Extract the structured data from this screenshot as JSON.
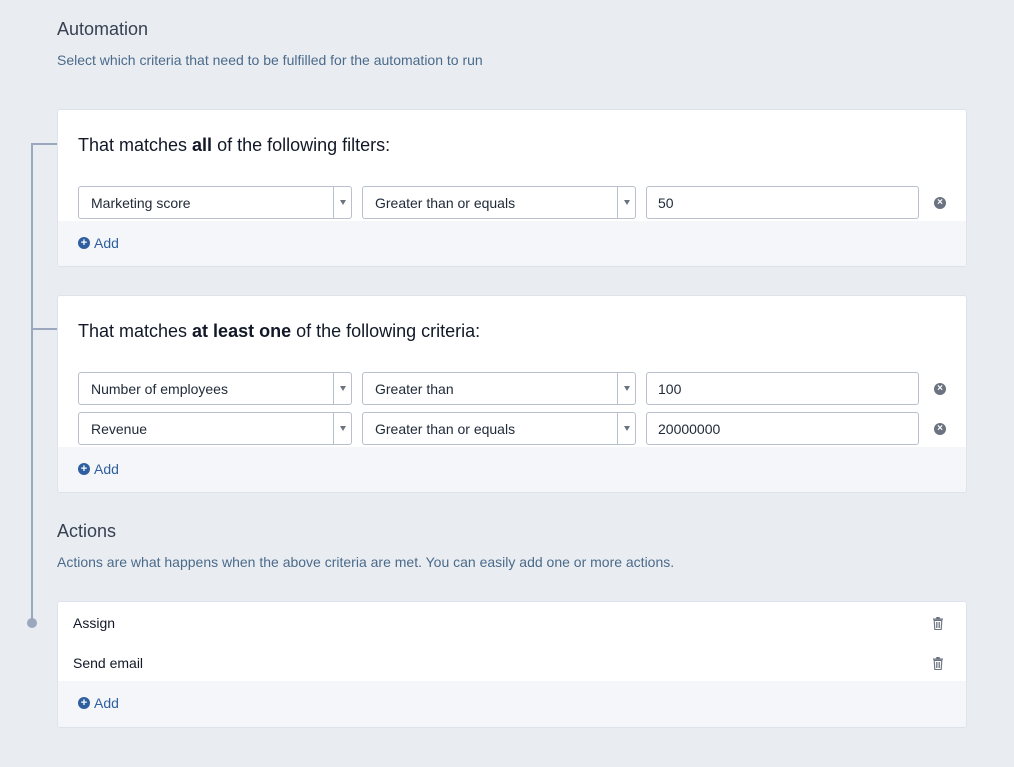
{
  "automation": {
    "title": "Automation",
    "description": "Select which criteria that need to be fulfilled for the automation to run"
  },
  "filters_all": {
    "heading_pre": "That matches ",
    "heading_bold": "all",
    "heading_post": " of the following filters:",
    "rows": [
      {
        "field": "Marketing score",
        "operator": "Greater than or equals",
        "value": "50"
      }
    ],
    "add_label": "Add"
  },
  "filters_any": {
    "heading_pre": "That matches ",
    "heading_bold": "at least one",
    "heading_post": " of the following criteria:",
    "rows": [
      {
        "field": "Number of employees",
        "operator": "Greater than",
        "value": "100"
      },
      {
        "field": "Revenue",
        "operator": "Greater than or equals",
        "value": "20000000"
      }
    ],
    "add_label": "Add"
  },
  "actions": {
    "title": "Actions",
    "description": "Actions are what happens when the above criteria are met. You can easily add one or more actions.",
    "items": [
      {
        "label": "Assign"
      },
      {
        "label": "Send email"
      }
    ],
    "add_label": "Add"
  },
  "icons": {
    "remove": "remove-circle-icon",
    "add": "plus-circle-icon",
    "trash": "trash-icon",
    "dropdown": "chevron-down-icon"
  },
  "colors": {
    "background": "#e9edf2",
    "link": "#2f5f9f",
    "connector": "#9aa7bf"
  }
}
